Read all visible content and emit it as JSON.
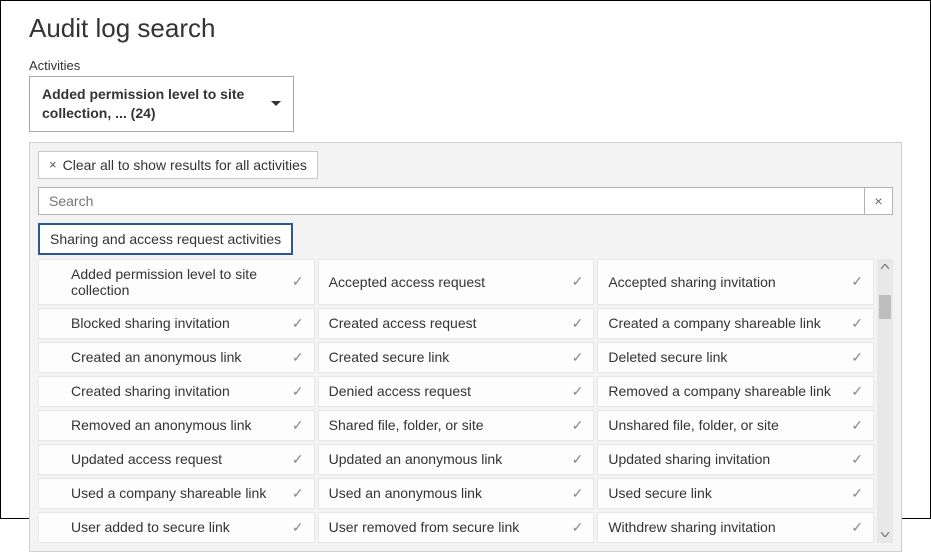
{
  "page": {
    "title": "Audit log search",
    "activities_label": "Activities"
  },
  "selector": {
    "text": "Added permission level to site collection, ... (24)"
  },
  "panel": {
    "clear_label": "Clear all to show results for all activities",
    "search_placeholder": "Search",
    "category_label": "Sharing and access request activities"
  },
  "activities": {
    "col1": [
      "Added permission level to site collection",
      "Blocked sharing invitation",
      "Created an anonymous link",
      "Created sharing invitation",
      "Removed an anonymous link",
      "Updated access request",
      "Used a company shareable link",
      "User added to secure link"
    ],
    "col2": [
      "Accepted access request",
      "Created access request",
      "Created secure link",
      "Denied access request",
      "Shared file, folder, or site",
      "Updated an anonymous link",
      "Used an anonymous link",
      "User removed from secure link"
    ],
    "col3": [
      "Accepted sharing invitation",
      "Created a company shareable link",
      "Deleted secure link",
      "Removed a company shareable link",
      "Unshared file, folder, or site",
      "Updated sharing invitation",
      "Used secure link",
      "Withdrew sharing invitation"
    ]
  },
  "icons": {
    "check": "✓",
    "x": "×"
  }
}
